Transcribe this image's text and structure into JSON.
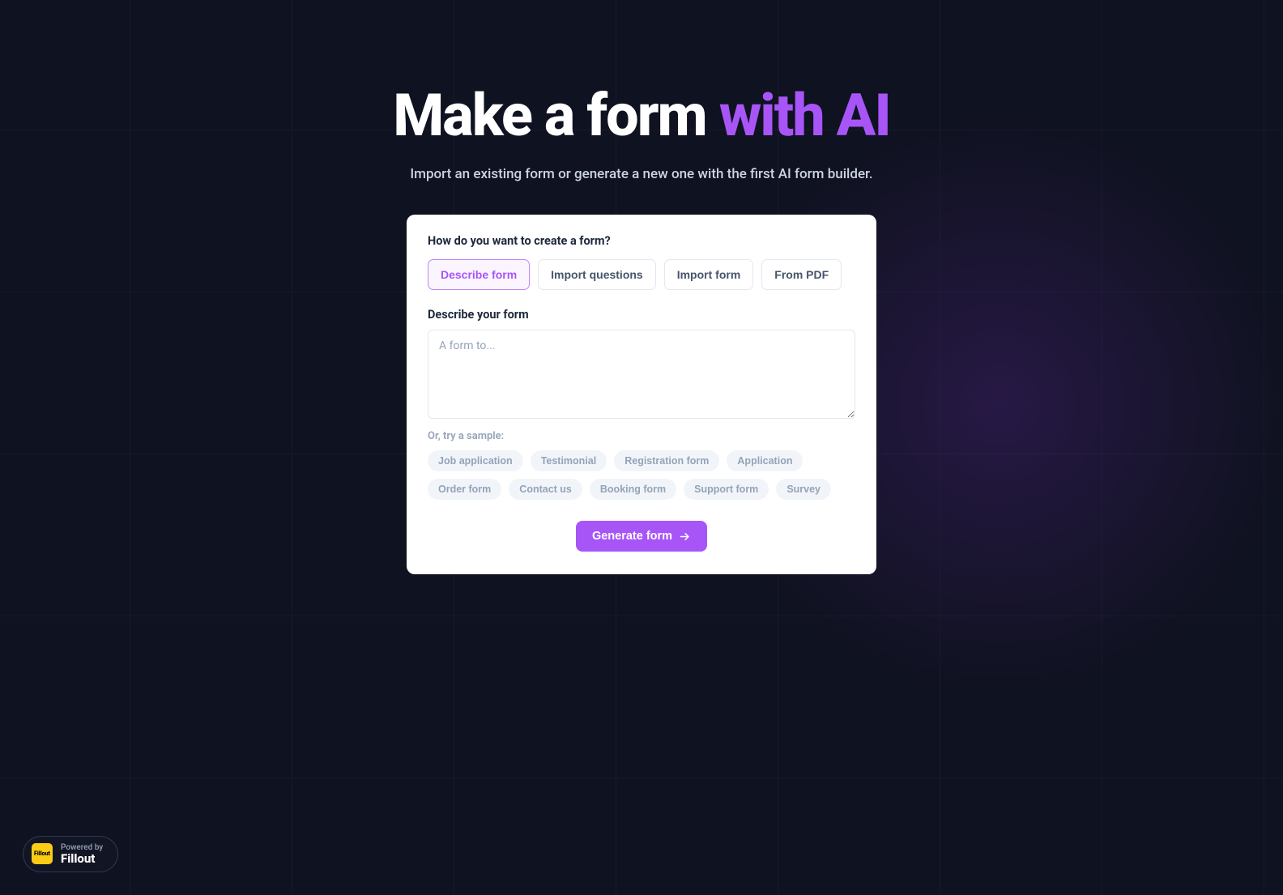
{
  "hero": {
    "title_main": "Make a form ",
    "title_accent": "with AI",
    "subtitle": "Import an existing form or generate a new one with the first AI form builder."
  },
  "card": {
    "prompt": "How do you want to create a form?",
    "tabs": [
      {
        "label": "Describe form",
        "active": true
      },
      {
        "label": "Import questions",
        "active": false
      },
      {
        "label": "Import form",
        "active": false
      },
      {
        "label": "From PDF",
        "active": false
      }
    ],
    "describe_label": "Describe your form",
    "textarea_placeholder": "A form to...",
    "textarea_value": "",
    "sample_label": "Or, try a sample:",
    "samples": [
      "Job application",
      "Testimonial",
      "Registration form",
      "Application",
      "Order form",
      "Contact us",
      "Booking form",
      "Support form",
      "Survey"
    ],
    "generate_label": "Generate form"
  },
  "footer": {
    "powered_by": "Powered by",
    "brand": "Fillout",
    "logo_text": "Fillout"
  }
}
